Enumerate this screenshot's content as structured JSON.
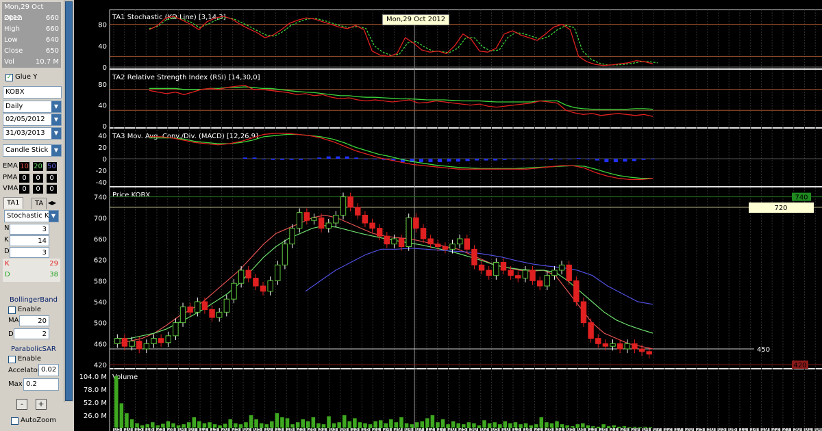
{
  "info": {
    "date": "Mon,29 Oct 2012",
    "rows": [
      {
        "label": "Open",
        "value": "660"
      },
      {
        "label": "High",
        "value": "660"
      },
      {
        "label": "Low",
        "value": "640"
      },
      {
        "label": "Close",
        "value": "650"
      },
      {
        "label": "Vol",
        "value": "10.7 M"
      }
    ]
  },
  "controls": {
    "glue_label": "Glue Y",
    "glue_checked": true,
    "symbol": "KOBX",
    "period": "Daily",
    "start_date": "02/05/2012",
    "end_date": "31/03/2013",
    "chart_style": "Candle Stick",
    "ma_table": {
      "headers": [
        "10",
        "20",
        "50"
      ],
      "rows": [
        {
          "label": "EMA",
          "values": [
            "10",
            "20",
            "50"
          ]
        },
        {
          "label": "PMA",
          "values": [
            "0",
            "0",
            "0"
          ]
        },
        {
          "label": "VMA",
          "values": [
            "0",
            "0",
            "0"
          ]
        }
      ]
    },
    "tabs": [
      "TA1",
      "TA"
    ],
    "indicator_select": "Stochastic KD",
    "params": [
      {
        "label": "N",
        "value": "3"
      },
      {
        "label": "K",
        "value": "14"
      },
      {
        "label": "D",
        "value": "3"
      }
    ],
    "k_label": "K",
    "k_value": "29",
    "d_label": "D",
    "d_value": "38",
    "bollinger": {
      "title": "BollingerBand",
      "enable_label": "Enable",
      "ma_label": "MA",
      "ma_value": "20",
      "d_label": "D",
      "d_value": "2"
    },
    "sar": {
      "title": "ParabolicSAR",
      "enable_label": "Enable",
      "accel_label": "Accelator",
      "accel_value": "0.02",
      "max_label": "Max",
      "max_value": "0.2"
    },
    "minus_label": "-",
    "plus_label": "+",
    "autozoom_label": "AutoZoom"
  },
  "colors": {
    "up": "#5fc83c",
    "down": "#e02020",
    "ema10": "#e05050",
    "ema20": "#6ee06e",
    "ema50": "#5050e0",
    "grid": "#7a7a7a",
    "accent_line": "#a0522d"
  },
  "chart_data": [
    {
      "type": "line",
      "title": "TA1 Stochastic (KD Line) [3,14,3]",
      "y_ticks": [
        "80",
        "40",
        "0"
      ],
      "tooltip": "Mon,29 Oct 2012",
      "ylim": [
        0,
        100
      ],
      "reference_lines": [
        80,
        20
      ],
      "series": [
        {
          "name": "K",
          "values": [
            70,
            78,
            92,
            95,
            88,
            80,
            70,
            85,
            92,
            95,
            90,
            80,
            72,
            65,
            55,
            60,
            70,
            82,
            88,
            92,
            90,
            85,
            80,
            75,
            72,
            78,
            70,
            30,
            22,
            20,
            25,
            55,
            45,
            32,
            28,
            30,
            25,
            40,
            62,
            52,
            30,
            28,
            35,
            62,
            68,
            60,
            55,
            50,
            62,
            75,
            80,
            70,
            20,
            10,
            5,
            3,
            4,
            6,
            8,
            12,
            10,
            6
          ]
        },
        {
          "name": "D",
          "values": [
            72,
            76,
            88,
            93,
            90,
            84,
            74,
            80,
            88,
            93,
            91,
            84,
            76,
            68,
            60,
            58,
            66,
            78,
            85,
            90,
            91,
            87,
            82,
            77,
            74,
            76,
            72,
            40,
            28,
            22,
            24,
            45,
            48,
            38,
            30,
            29,
            27,
            35,
            55,
            55,
            38,
            30,
            32,
            55,
            65,
            62,
            57,
            52,
            58,
            70,
            78,
            74,
            30,
            15,
            7,
            4,
            4,
            5,
            7,
            10,
            10,
            8
          ]
        }
      ]
    },
    {
      "type": "line",
      "title": "TA2 Relative Strength Index (RSI) [14,30,0]",
      "y_ticks": [
        "80",
        "40",
        "0"
      ],
      "ylim": [
        0,
        100
      ],
      "reference_lines": [
        70,
        30
      ],
      "series": [
        {
          "name": "RSI",
          "values": [
            68,
            65,
            62,
            65,
            60,
            65,
            70,
            72,
            70,
            74,
            76,
            78,
            70,
            70,
            68,
            66,
            64,
            60,
            62,
            58,
            60,
            55,
            52,
            54,
            50,
            48,
            50,
            48,
            46,
            48,
            50,
            44,
            45,
            48,
            46,
            44,
            42,
            40,
            42,
            38,
            36,
            38,
            40,
            42,
            44,
            48,
            46,
            44,
            30,
            25,
            22,
            24,
            20,
            22,
            24,
            22,
            20,
            22,
            18
          ]
        },
        {
          "name": "Signal",
          "values": [
            72,
            72,
            72,
            72,
            70,
            70,
            70,
            72,
            72,
            74,
            74,
            75,
            74,
            72,
            72,
            70,
            68,
            66,
            65,
            64,
            62,
            60,
            58,
            58,
            56,
            55,
            55,
            54,
            53,
            52,
            52,
            51,
            50,
            50,
            50,
            49,
            48,
            48,
            48,
            47,
            46,
            46,
            46,
            46,
            46,
            48,
            48,
            48,
            40,
            35,
            33,
            32,
            32,
            32,
            32,
            32,
            33,
            33,
            32
          ]
        }
      ]
    },
    {
      "type": "line",
      "title": "TA3 Mov. Avg. Conv./Div. (MACD) [12,26,9]",
      "y_ticks": [
        "40",
        "20",
        "0",
        "-20",
        "-40"
      ],
      "ylim": [
        -45,
        45
      ],
      "series": [
        {
          "name": "MACD",
          "values": [
            38,
            38,
            36,
            32,
            28,
            26,
            24,
            26,
            30,
            36,
            42,
            44,
            44,
            42,
            40,
            36,
            30,
            22,
            14,
            8,
            2,
            -2,
            -6,
            -10,
            -12,
            -14,
            -16,
            -18,
            -18,
            -18,
            -18,
            -18,
            -18,
            -18,
            -16,
            -14,
            -12,
            -12,
            -16,
            -24,
            -30,
            -34,
            -36,
            -36,
            -34
          ]
        },
        {
          "name": "Signal",
          "values": [
            36,
            36,
            36,
            34,
            30,
            28,
            26,
            26,
            28,
            32,
            38,
            40,
            42,
            42,
            40,
            38,
            34,
            28,
            20,
            14,
            8,
            4,
            -1,
            -5,
            -8,
            -11,
            -13,
            -15,
            -16,
            -17,
            -17,
            -17,
            -17,
            -16,
            -15,
            -14,
            -13,
            -12,
            -13,
            -18,
            -24,
            -29,
            -32,
            -34,
            -34
          ]
        }
      ],
      "histogram": [
        2,
        2,
        0,
        -2,
        -2,
        -2,
        -2,
        0,
        2,
        4,
        4,
        4,
        2,
        0,
        0,
        -2,
        -4,
        -6,
        -6,
        -6,
        -6,
        -6,
        -5,
        -5,
        -4,
        -3,
        -3,
        -3,
        -2,
        -1,
        -1,
        -1,
        -1,
        -2,
        -1,
        0,
        1,
        0,
        -3,
        -6,
        -6,
        -5,
        -4,
        -2,
        0
      ]
    },
    {
      "type": "line",
      "title": "Price KOBX",
      "y_ticks": [
        "740",
        "700",
        "660",
        "620",
        "580",
        "540",
        "500",
        "460",
        "420"
      ],
      "ylim": [
        420,
        750
      ],
      "reference_lines": [
        {
          "value": 740,
          "label": "740"
        },
        {
          "value": 720,
          "label": "720"
        },
        {
          "value": 450,
          "label": "450"
        },
        {
          "value": 420,
          "label": "420"
        }
      ],
      "candles": [
        {
          "o": 460,
          "c": 470
        },
        {
          "o": 470,
          "c": 455
        },
        {
          "o": 455,
          "c": 465
        },
        {
          "o": 465,
          "c": 450
        },
        {
          "o": 450,
          "c": 460
        },
        {
          "o": 460,
          "c": 470
        },
        {
          "o": 470,
          "c": 462
        },
        {
          "o": 462,
          "c": 475
        },
        {
          "o": 475,
          "c": 500
        },
        {
          "o": 500,
          "c": 530
        },
        {
          "o": 530,
          "c": 520
        },
        {
          "o": 520,
          "c": 540
        },
        {
          "o": 540,
          "c": 525
        },
        {
          "o": 525,
          "c": 510
        },
        {
          "o": 510,
          "c": 520
        },
        {
          "o": 520,
          "c": 545
        },
        {
          "o": 545,
          "c": 575
        },
        {
          "o": 575,
          "c": 600
        },
        {
          "o": 600,
          "c": 585
        },
        {
          "o": 585,
          "c": 570
        },
        {
          "o": 570,
          "c": 560
        },
        {
          "o": 560,
          "c": 580
        },
        {
          "o": 580,
          "c": 610
        },
        {
          "o": 610,
          "c": 650
        },
        {
          "o": 650,
          "c": 680
        },
        {
          "o": 680,
          "c": 710
        },
        {
          "o": 710,
          "c": 695
        },
        {
          "o": 695,
          "c": 700
        },
        {
          "o": 700,
          "c": 680
        },
        {
          "o": 680,
          "c": 690
        },
        {
          "o": 690,
          "c": 705
        },
        {
          "o": 705,
          "c": 740
        },
        {
          "o": 740,
          "c": 720
        },
        {
          "o": 720,
          "c": 705
        },
        {
          "o": 705,
          "c": 690
        },
        {
          "o": 690,
          "c": 680
        },
        {
          "o": 680,
          "c": 665
        },
        {
          "o": 665,
          "c": 650
        },
        {
          "o": 650,
          "c": 660
        },
        {
          "o": 660,
          "c": 645
        },
        {
          "o": 645,
          "c": 700
        },
        {
          "o": 700,
          "c": 680
        },
        {
          "o": 680,
          "c": 660
        },
        {
          "o": 660,
          "c": 650
        },
        {
          "o": 650,
          "c": 645
        },
        {
          "o": 645,
          "c": 640
        },
        {
          "o": 640,
          "c": 650
        },
        {
          "o": 650,
          "c": 660
        },
        {
          "o": 660,
          "c": 640
        },
        {
          "o": 640,
          "c": 610
        },
        {
          "o": 610,
          "c": 600
        },
        {
          "o": 600,
          "c": 590
        },
        {
          "o": 590,
          "c": 615
        },
        {
          "o": 615,
          "c": 600
        },
        {
          "o": 600,
          "c": 590
        },
        {
          "o": 590,
          "c": 585
        },
        {
          "o": 585,
          "c": 600
        },
        {
          "o": 600,
          "c": 580
        },
        {
          "o": 580,
          "c": 570
        },
        {
          "o": 570,
          "c": 590
        },
        {
          "o": 590,
          "c": 600
        },
        {
          "o": 600,
          "c": 610
        },
        {
          "o": 610,
          "c": 580
        },
        {
          "o": 580,
          "c": 540
        },
        {
          "o": 540,
          "c": 500
        },
        {
          "o": 500,
          "c": 470
        },
        {
          "o": 470,
          "c": 460
        },
        {
          "o": 460,
          "c": 455
        },
        {
          "o": 455,
          "c": 460
        },
        {
          "o": 460,
          "c": 450
        },
        {
          "o": 450,
          "c": 460
        },
        {
          "o": 460,
          "c": 450
        },
        {
          "o": 450,
          "c": 445
        },
        {
          "o": 445,
          "c": 440
        }
      ],
      "ema": [
        {
          "name": "EMA10",
          "values": [
            460,
            465,
            470,
            480,
            495,
            512,
            525,
            540,
            560,
            580,
            600,
            625,
            650,
            670,
            680,
            690,
            700,
            705,
            700,
            690,
            680,
            670,
            665,
            662,
            660,
            655,
            650,
            645,
            640,
            630,
            620,
            610,
            605,
            600,
            598,
            600,
            590,
            560,
            530,
            500,
            480,
            470,
            460,
            455,
            450
          ]
        },
        {
          "name": "EMA20",
          "values": [
            470,
            470,
            475,
            480,
            488,
            500,
            512,
            525,
            540,
            555,
            575,
            600,
            625,
            645,
            660,
            670,
            680,
            685,
            682,
            676,
            670,
            665,
            660,
            656,
            652,
            648,
            643,
            638,
            632,
            625,
            618,
            610,
            605,
            602,
            600,
            600,
            596,
            580,
            560,
            540,
            520,
            505,
            495,
            487,
            480
          ]
        },
        {
          "name": "EMA50",
          "values": [
            560,
            580,
            600,
            615,
            630,
            640,
            640,
            642,
            640,
            638,
            636,
            634,
            630,
            625,
            618,
            612,
            608,
            605,
            600,
            590,
            570,
            555,
            540,
            535
          ]
        }
      ]
    },
    {
      "type": "bar",
      "title": "Volume",
      "y_ticks": [
        "104.0 M",
        "78.0 M",
        "52.0 M",
        "26.0 M"
      ],
      "ylim": [
        0,
        104
      ],
      "values": [
        104,
        50,
        30,
        18,
        10,
        6,
        8,
        12,
        6,
        9,
        14,
        10,
        6,
        8,
        12,
        22,
        14,
        10,
        12,
        8,
        6,
        9,
        18,
        10,
        8,
        12,
        26,
        18,
        10,
        8,
        14,
        30,
        22,
        20,
        8,
        12,
        18,
        14,
        22,
        10,
        8,
        24,
        10,
        12,
        26,
        14,
        20,
        12,
        10,
        8,
        14,
        16,
        10,
        18,
        12,
        22,
        10,
        8,
        12,
        14,
        20,
        26,
        12,
        18,
        8,
        14,
        10,
        8,
        12,
        10,
        6,
        16,
        10,
        12,
        8,
        14,
        10,
        12,
        8,
        10,
        6,
        8,
        22,
        12,
        10,
        14,
        8,
        6,
        4,
        8,
        10,
        6,
        4,
        3,
        8,
        4,
        6,
        3,
        4,
        2,
        3,
        2,
        3,
        2
      ]
    }
  ],
  "x_axis_labels": [
    "05",
    "10",
    "15",
    "18",
    "23",
    "28",
    "04",
    "07",
    "12",
    "15",
    "20",
    "25",
    "02",
    "05",
    "10",
    "13",
    "18",
    "23",
    "26",
    "31",
    "03",
    "08",
    "13",
    "16",
    "21",
    "24",
    "29",
    "04",
    "07",
    "12",
    "17",
    "20",
    "25",
    "30",
    "02",
    "05",
    "10",
    "13",
    "18",
    "21",
    "26",
    "31",
    "05",
    "08",
    "13",
    "16",
    "21",
    "24",
    "29",
    "04",
    "07",
    "12",
    "17",
    "20",
    "25",
    "30",
    "03",
    "06",
    "11",
    "14",
    "19",
    "22",
    "27",
    "30",
    "01",
    "04"
  ]
}
